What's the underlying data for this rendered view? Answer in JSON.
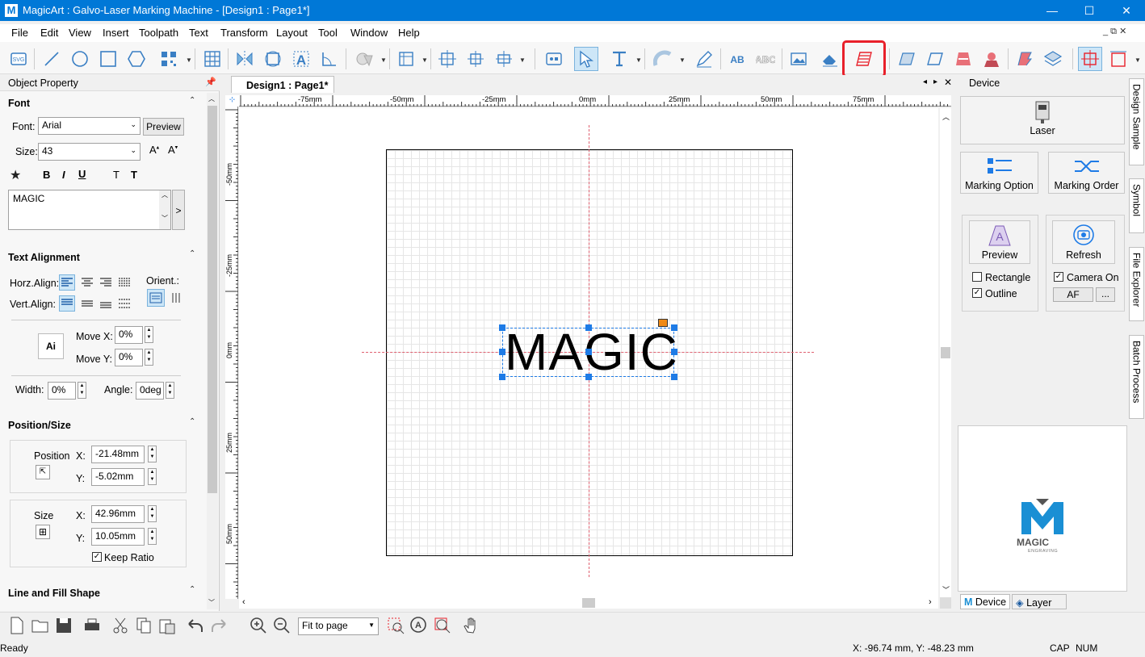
{
  "titlebar": {
    "title": "MagicArt : Galvo-Laser Marking Machine - [Design1 : Page1*]",
    "minimize": "—",
    "maximize": "☐",
    "close": "✕"
  },
  "menu": [
    "File",
    "Edit",
    "View",
    "Insert",
    "Toolpath",
    "Text",
    "Transform",
    "Layout",
    "Tool",
    "Window",
    "Help"
  ],
  "mdi_controls": "_ ⧉ ✕",
  "left": {
    "panel_title": "Object Property",
    "font_section": "Font",
    "font_label": "Font:",
    "font_value": "Arial",
    "preview_btn": "Preview",
    "size_label": "Size:",
    "size_value": "43",
    "text_value": "MAGIC",
    "text_more": ">",
    "align_section": "Text Alignment",
    "horz_label": "Horz.Align:",
    "vert_label": "Vert.Align:",
    "orient_label": "Orient.:",
    "movex_label": "Move X:",
    "movex_value": "0%",
    "movey_label": "Move Y:",
    "movey_value": "0%",
    "width_label": "Width:",
    "width_value": "0%",
    "angle_label": "Angle:",
    "angle_value": "0deg",
    "pos_section": "Position/Size",
    "position_label": "Position",
    "x_label": "X:",
    "y_label": "Y:",
    "pos_x": "-21.48mm",
    "pos_y": "-5.02mm",
    "size_sec_label": "Size",
    "size_x": "42.96mm",
    "size_y": "10.05mm",
    "keep_ratio": "Keep Ratio",
    "line_section": "Line and Fill Shape"
  },
  "doc": {
    "tab": "Design1 : Page1*",
    "ruler_top": [
      "-75mm",
      "-50mm",
      "-25mm",
      "0mm",
      "25mm",
      "50mm",
      "75mm"
    ],
    "ruler_left": [
      "-50mm",
      "-25mm",
      "0mm",
      "25mm",
      "50mm"
    ],
    "canvas_text": "MAGIC"
  },
  "right": {
    "panel_title": "Device",
    "laser": "Laser",
    "marking_option": "Marking Option",
    "marking_order": "Marking Order",
    "preview": "Preview",
    "refresh": "Refresh",
    "rectangle": "Rectangle",
    "outline": "Outline",
    "camera_on": "Camera On",
    "af": "AF",
    "more": "...",
    "logo_main": "MAGIC",
    "logo_sub": "ENGRAVING",
    "tab_device": "Device",
    "tab_layer": "Layer"
  },
  "sidetabs": [
    "Design Sample",
    "Symbol",
    "File Explorer",
    "Batch Process"
  ],
  "bottom": {
    "zoom_value": "Fit to page"
  },
  "status": {
    "ready": "Ready",
    "coords": "X: -96.74 mm,  Y: -48.23 mm",
    "cap": "CAP",
    "num": "NUM"
  },
  "colors": {
    "accent": "#0078d7",
    "highlight": "#e8202a",
    "selection": "#1e7be6"
  }
}
